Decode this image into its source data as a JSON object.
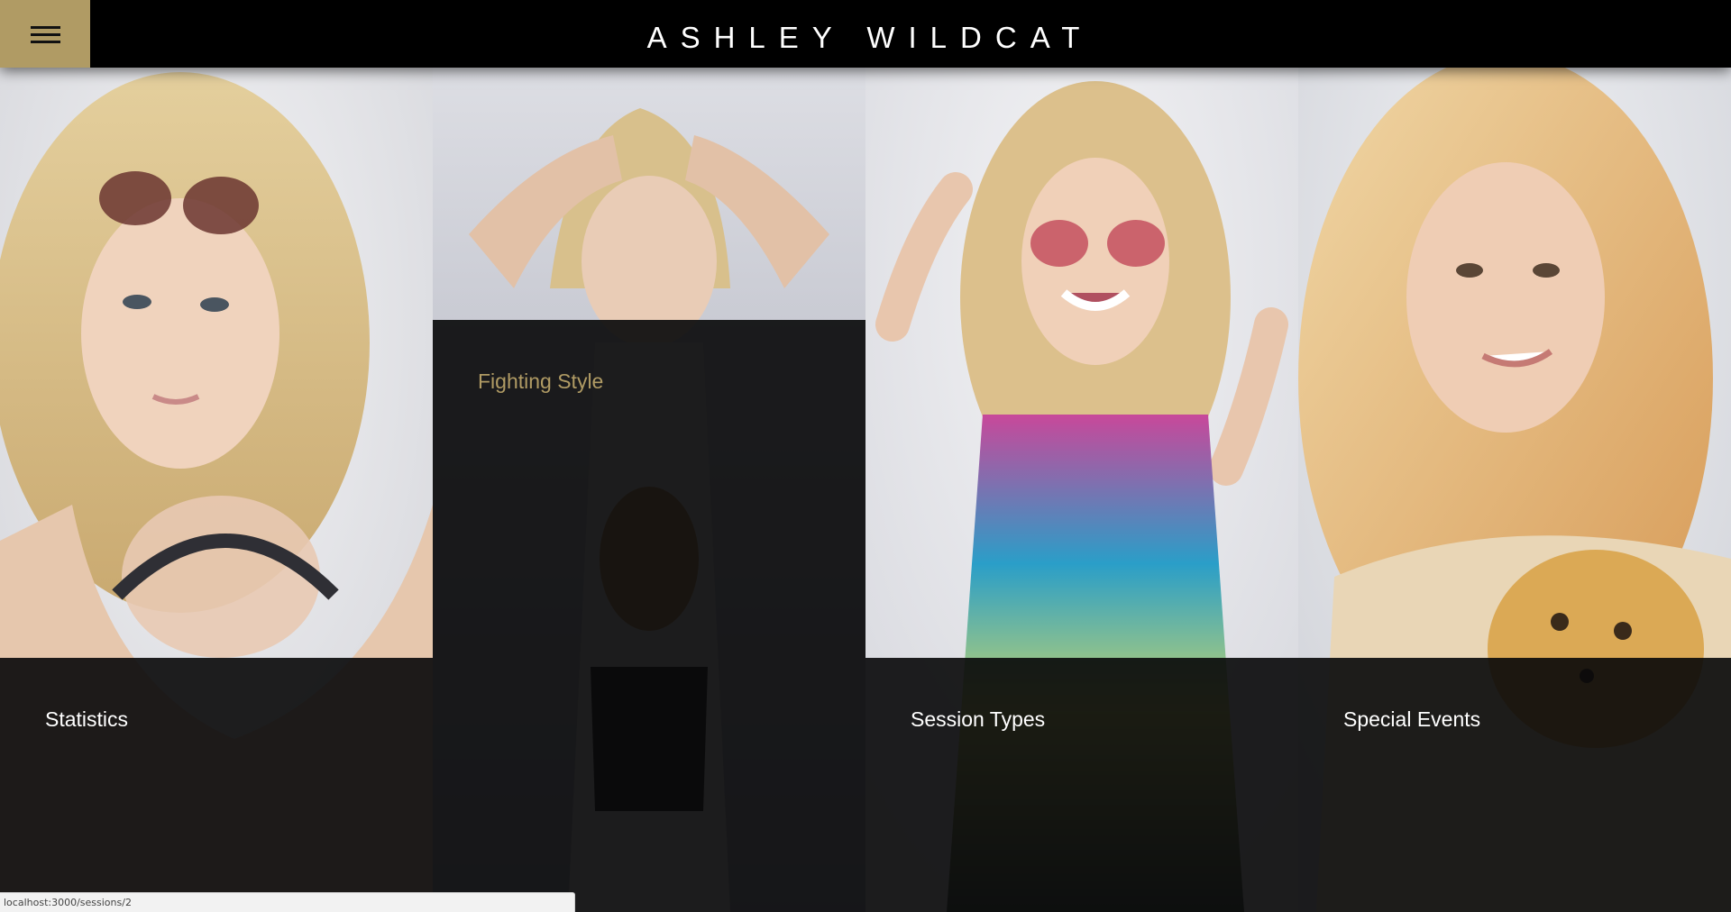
{
  "site": {
    "title": "ASHLEY WILDCAT",
    "menu_icon": "hamburger-menu-icon",
    "accent_color": "#b09b64"
  },
  "panels": [
    {
      "label": "Statistics",
      "label_color": "#ffffff"
    },
    {
      "label": "Fighting Style",
      "label_color": "#b09b64"
    },
    {
      "label": "Session Types",
      "label_color": "#ffffff"
    },
    {
      "label": "Special Events",
      "label_color": "#ffffff"
    }
  ],
  "status_bar": {
    "url": "localhost:3000/sessions/2"
  }
}
